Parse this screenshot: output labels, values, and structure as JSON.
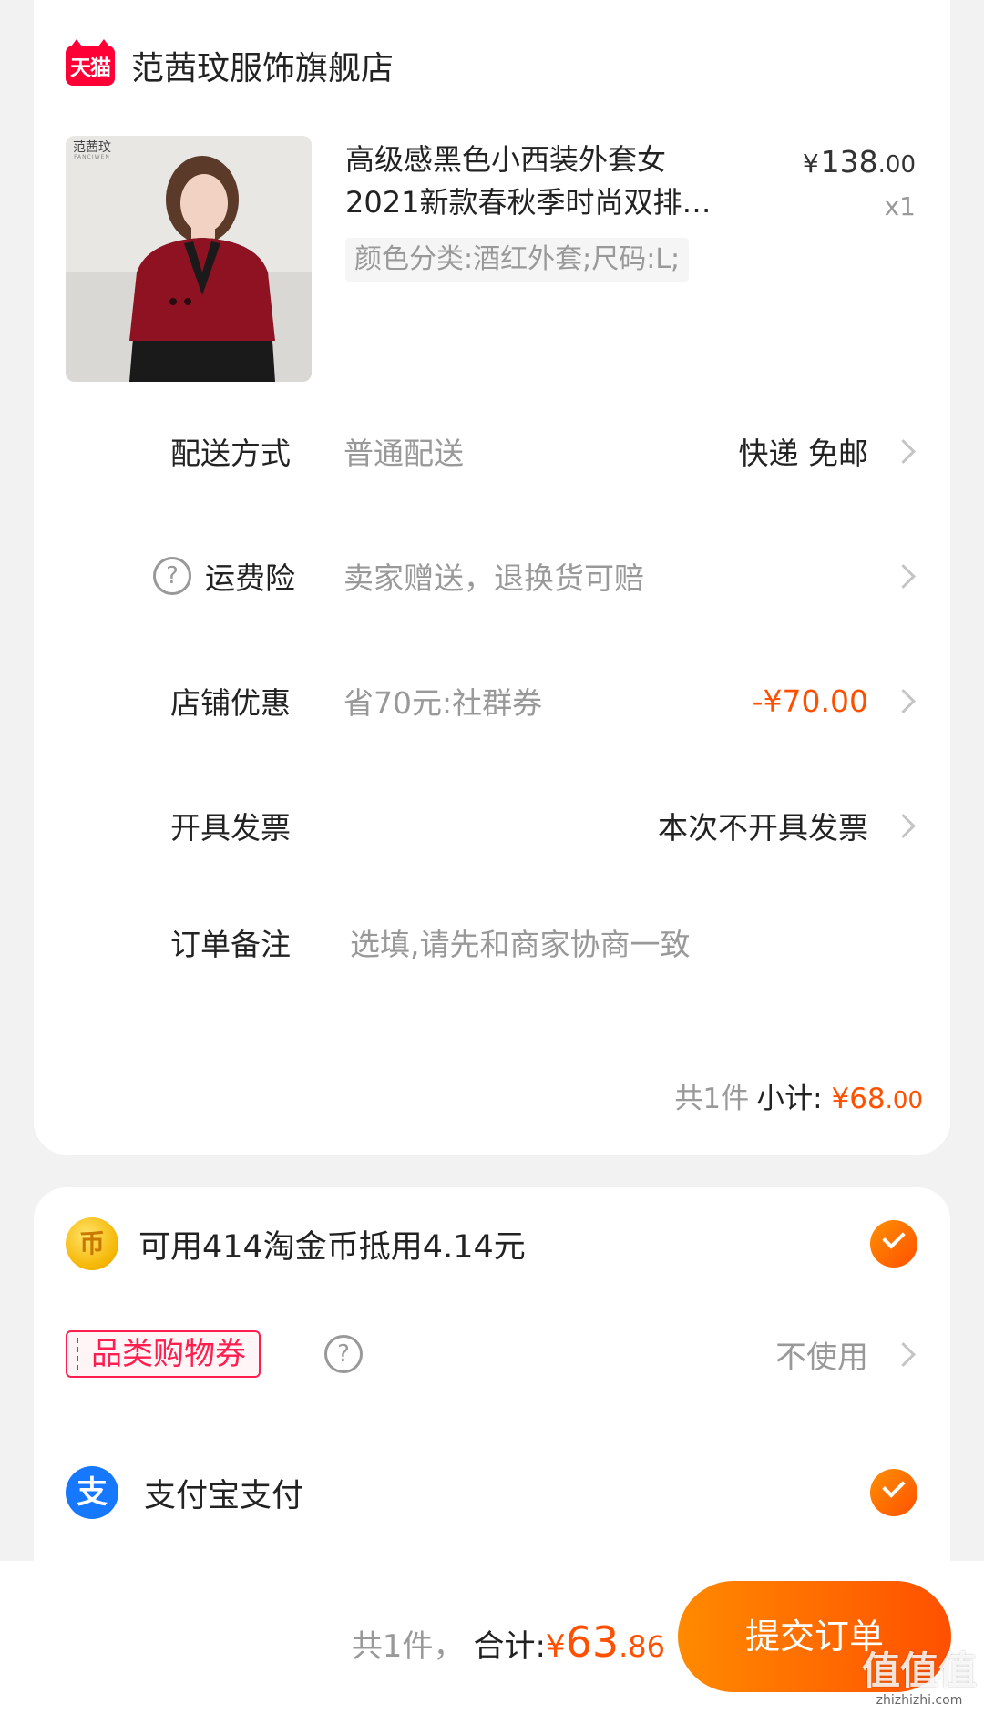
{
  "store": {
    "badge": "天猫",
    "name": "范茜玟服饰旗舰店"
  },
  "product": {
    "thumb_brand": "范茜玟",
    "thumb_brand_sub": "FANCIWEN",
    "title_line1": "高级感黑色小西装外套女",
    "title_line2": "2021新款春秋季时尚双排…",
    "sku": "颜色分类:酒红外套;尺码:L;",
    "price_currency": "¥",
    "price_int": "138",
    "price_dec": ".00",
    "qty": "x1"
  },
  "rows": {
    "delivery": {
      "label": "配送方式",
      "sub": "普通配送",
      "value": "快递 免邮"
    },
    "insurance": {
      "label": "运费险",
      "sub": "卖家赠送，退换货可赔"
    },
    "discount": {
      "label": "店铺优惠",
      "sub": "省70元:社群券",
      "value": "-¥70.00"
    },
    "invoice": {
      "label": "开具发票",
      "value": "本次不开具发票"
    },
    "remark": {
      "label": "订单备注",
      "placeholder": "选填,请先和商家协商一致"
    }
  },
  "subtotal": {
    "count": "共1件",
    "label": "小计:",
    "currency": "¥",
    "amount_int": "68",
    "amount_dec": ".00"
  },
  "payment": {
    "coin_icon": "币",
    "coin_text": "可用414淘金币抵用4.14元",
    "coupon_tag": "品类购物券",
    "coupon_value": "不使用",
    "alipay_icon": "支",
    "alipay_text": "支付宝支付"
  },
  "bottom": {
    "count": "共1件，",
    "label": "合计:",
    "currency": "¥",
    "amount_int": "63",
    "amount_dec": ".86",
    "submit": "提交订单"
  },
  "watermark": {
    "text": "值值值",
    "url": "zhizhizhi.com"
  },
  "colors": {
    "accent": "#ff5000",
    "tmall_red": "#ff0036",
    "alipay_blue": "#1677ff"
  }
}
